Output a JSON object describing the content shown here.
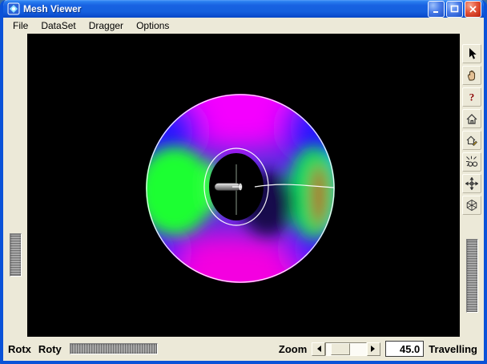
{
  "window": {
    "title": "Mesh Viewer",
    "controls": {
      "minimize": "minimize",
      "maximize": "maximize",
      "close": "close"
    }
  },
  "menu": {
    "items": [
      "File",
      "DataSet",
      "Dragger",
      "Options"
    ]
  },
  "toolbar": {
    "help_glyph": "?",
    "buttons": [
      {
        "name": "pick-mode",
        "icon": "pointer-arrow-icon"
      },
      {
        "name": "view-mode",
        "icon": "hand-icon"
      },
      {
        "name": "help",
        "icon": "question-mark-icon"
      },
      {
        "name": "home",
        "icon": "home-icon"
      },
      {
        "name": "set-home",
        "icon": "set-home-icon"
      },
      {
        "name": "view-all",
        "icon": "view-all-icon"
      },
      {
        "name": "seek",
        "icon": "seek-icon"
      },
      {
        "name": "camera-type",
        "icon": "camera-wireframe-icon"
      }
    ]
  },
  "viewport": {
    "model": "torus-mesh-with-center-dragger"
  },
  "bottom": {
    "rotx": "Rotx",
    "roty": "Roty",
    "zoom": "Zoom",
    "zoom_value": "45.0",
    "mode": "Travelling"
  },
  "colors": {
    "titlebar": "#1560de",
    "chrome": "#ece9d8",
    "viewport_bg": "#000000",
    "close_button": "#e4553a"
  }
}
